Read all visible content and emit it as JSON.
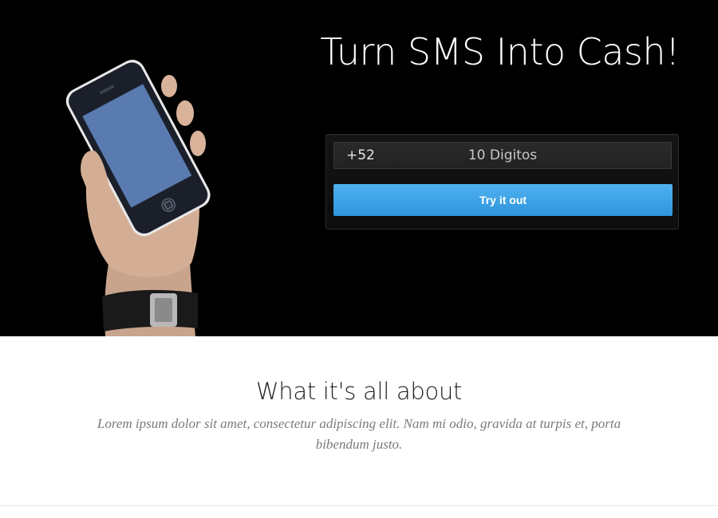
{
  "hero": {
    "title": "Turn SMS Into Cash!",
    "image_name": "hand-holding-phone"
  },
  "form": {
    "country_code": "+52",
    "phone_placeholder": "10 Digitos",
    "phone_value": "",
    "submit_label": "Try it out"
  },
  "about": {
    "heading": "What it's all about",
    "text": "Lorem ipsum dolor sit amet, consectetur adipiscing elit. Nam mi odio, gravida at turpis et, porta bibendum justo."
  },
  "colors": {
    "hero_background": "#000000",
    "button": "#3aa2e6",
    "screen": "#5a7bb0"
  }
}
